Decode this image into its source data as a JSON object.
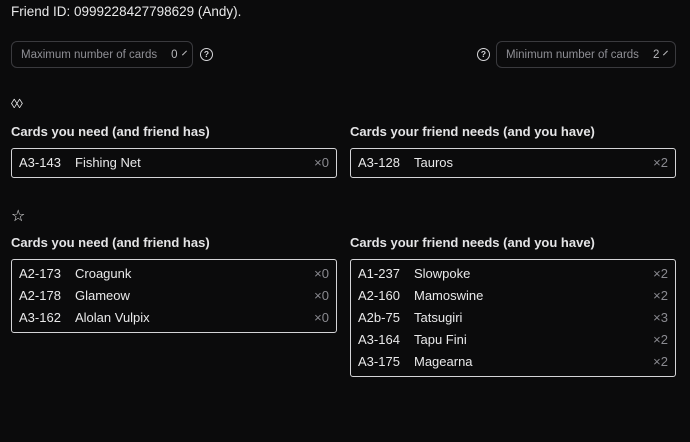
{
  "friend": {
    "id_text": "Friend ID: 0999228427798629 (Andy)."
  },
  "filters": {
    "max": {
      "placeholder": "Maximum number of cards",
      "value": "0"
    },
    "min": {
      "placeholder": "Minimum number of cards",
      "value": "2"
    }
  },
  "sections": [
    {
      "rarity_symbol": "◊◊",
      "need": {
        "title": "Cards you need (and friend has)",
        "cards": [
          {
            "id": "A3-143",
            "name": "Fishing Net",
            "count": "×0"
          }
        ]
      },
      "give": {
        "title": "Cards your friend needs (and you have)",
        "cards": [
          {
            "id": "A3-128",
            "name": "Tauros",
            "count": "×2"
          }
        ]
      }
    },
    {
      "rarity_symbol": "☆",
      "need": {
        "title": "Cards you need (and friend has)",
        "cards": [
          {
            "id": "A2-173",
            "name": "Croagunk",
            "count": "×0"
          },
          {
            "id": "A2-178",
            "name": "Glameow",
            "count": "×0"
          },
          {
            "id": "A3-162",
            "name": "Alolan Vulpix",
            "count": "×0"
          }
        ]
      },
      "give": {
        "title": "Cards your friend needs (and you have)",
        "cards": [
          {
            "id": "A1-237",
            "name": "Slowpoke",
            "count": "×2"
          },
          {
            "id": "A2-160",
            "name": "Mamoswine",
            "count": "×2"
          },
          {
            "id": "A2b-75",
            "name": "Tatsugiri",
            "count": "×3"
          },
          {
            "id": "A3-164",
            "name": "Tapu Fini",
            "count": "×2"
          },
          {
            "id": "A3-175",
            "name": "Magearna",
            "count": "×2"
          }
        ]
      }
    }
  ]
}
